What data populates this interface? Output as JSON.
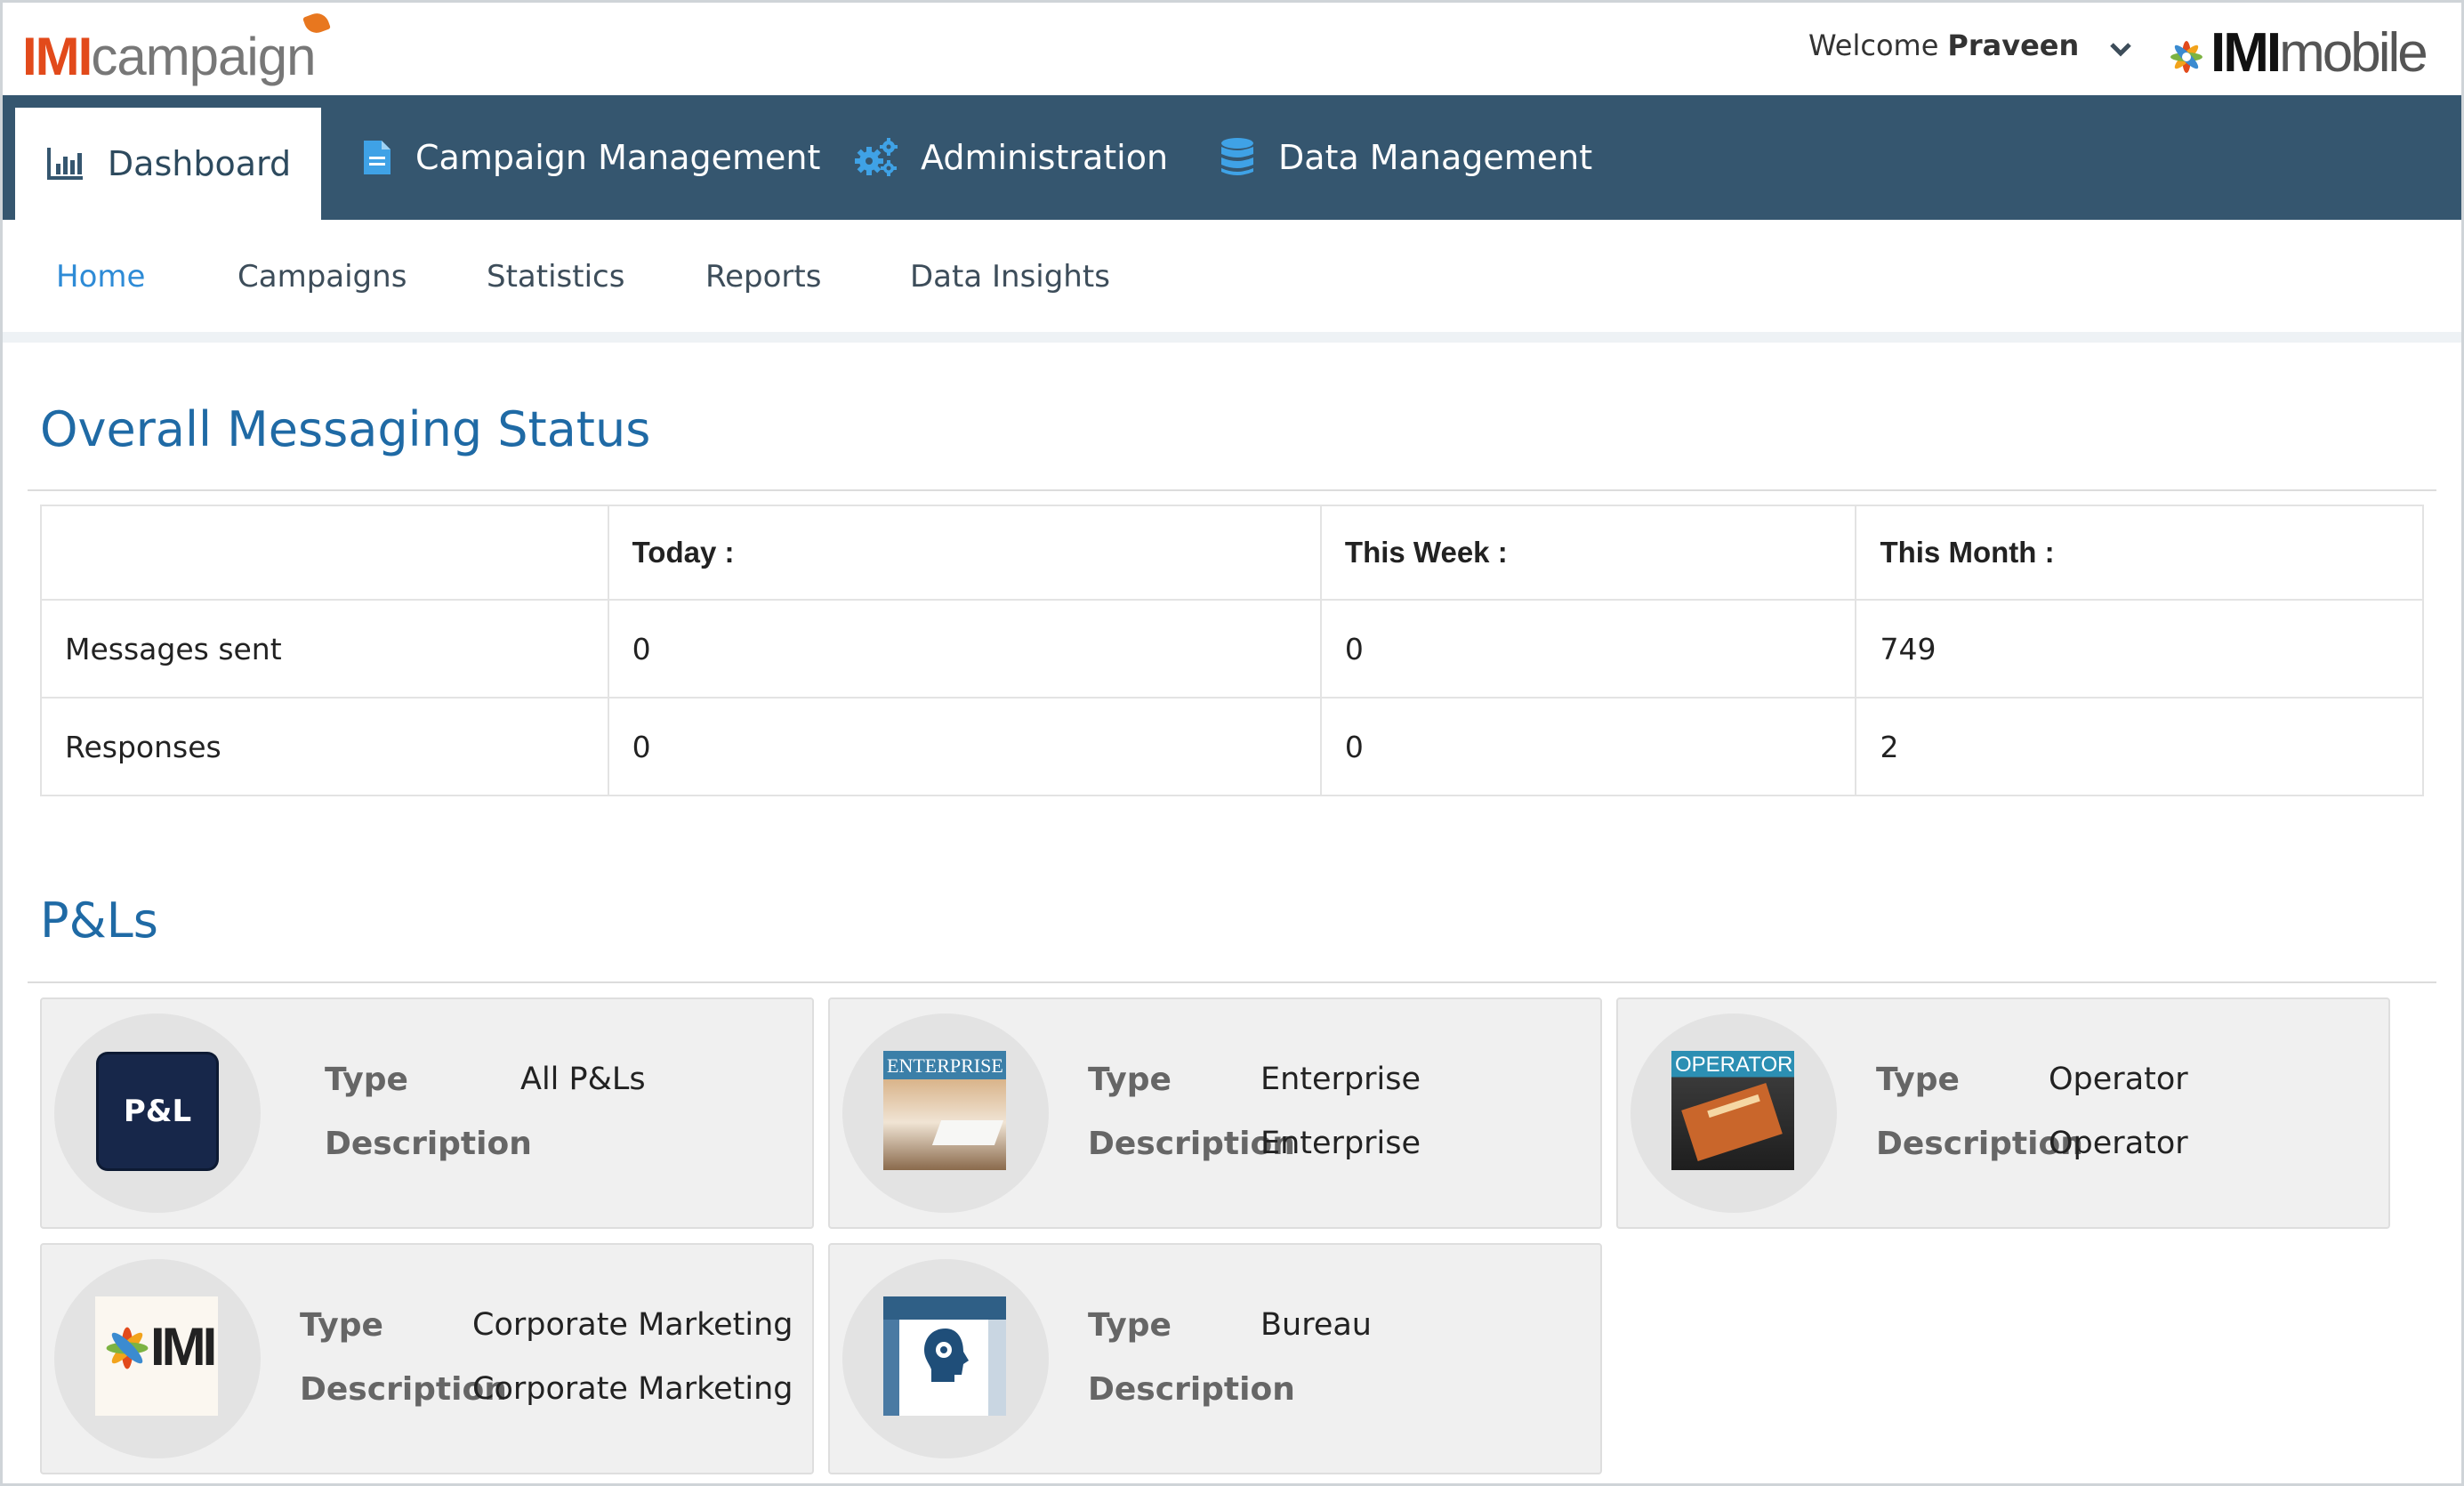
{
  "header": {
    "app_name_prefix": "IMI",
    "app_name_suffix": "campaign",
    "welcome_label": "Welcome",
    "user_name": "Praveen",
    "brand_prefix": "IMI",
    "brand_suffix": "mobile"
  },
  "main_nav": {
    "tabs": [
      {
        "label": "Dashboard",
        "icon": "bar-chart-icon",
        "active": true
      },
      {
        "label": "Campaign Management",
        "icon": "document-icon"
      },
      {
        "label": "Administration",
        "icon": "gears-icon"
      },
      {
        "label": "Data Management",
        "icon": "database-icon"
      }
    ]
  },
  "sub_nav": {
    "tabs": [
      {
        "label": "Home",
        "active": true
      },
      {
        "label": "Campaigns"
      },
      {
        "label": "Statistics"
      },
      {
        "label": "Reports"
      },
      {
        "label": "Data Insights"
      }
    ]
  },
  "messaging": {
    "title": "Overall Messaging Status",
    "columns": [
      "",
      "Today :",
      "This Week :",
      "This Month :"
    ],
    "rows": [
      {
        "label": "Messages sent",
        "values": [
          "0",
          "0",
          "749"
        ]
      },
      {
        "label": "Responses",
        "values": [
          "0",
          "0",
          "2"
        ]
      }
    ]
  },
  "pnls": {
    "title": "P&Ls",
    "type_label": "Type",
    "description_label": "Description",
    "cards": [
      {
        "type": "All P&Ls",
        "description": "",
        "thumb_text": "P&L"
      },
      {
        "type": "Enterprise",
        "description": "Enterprise",
        "thumb_text": "ENTERPRISE"
      },
      {
        "type": "Operator",
        "description": "Operator",
        "thumb_text": "OPERATOR"
      },
      {
        "type": "Corporate Marketing",
        "description": "Corporate Marketing",
        "thumb_text": "IMI"
      },
      {
        "type": "Bureau",
        "description": ""
      }
    ]
  },
  "colors": {
    "nav_bg": "#35566f",
    "accent_blue": "#1f6aa5",
    "active_subtab": "#2e8bd6",
    "logo_orange": "#e24a1b"
  }
}
